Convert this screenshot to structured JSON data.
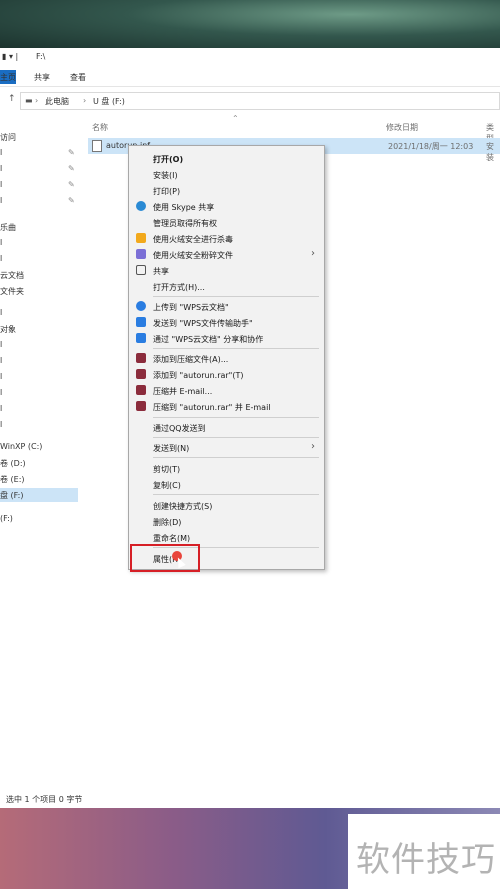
{
  "explorer": {
    "title_path": "F:\\",
    "ribbon_tabs": [
      "主页",
      "共享",
      "查看"
    ],
    "breadcrumb": [
      "此电脑",
      "U 盘 (F:)"
    ],
    "nav_items": [
      "访问",
      "",
      "",
      "",
      "",
      "乐曲",
      "",
      "云文档",
      "文件夹",
      "",
      "对象",
      "",
      "",
      "",
      "",
      "",
      "WinXP (C:)",
      "卷 (D:)",
      "卷 (E:)",
      "盘 (F:)",
      "",
      "(F:)"
    ],
    "columns": {
      "name": "名称",
      "date": "修改日期",
      "type": "类型"
    },
    "file": {
      "name": "autorun.inf",
      "date": "2021/1/18/周一 12:03",
      "type": "安装"
    },
    "status": "选中 1 个项目  0 字节"
  },
  "menu": {
    "items": [
      {
        "label": "打开(O)",
        "icon": "",
        "bold": true
      },
      {
        "label": "安装(I)",
        "icon": ""
      },
      {
        "label": "打印(P)",
        "icon": ""
      },
      {
        "label": "使用 Skype 共享",
        "icon": "skype-icon",
        "color": "#2a8ad4"
      },
      {
        "label": "管理员取得所有权",
        "icon": ""
      },
      {
        "label": "使用火绒安全进行杀毒",
        "icon": "huorong-icon",
        "color": "#f2a91c"
      },
      {
        "label": "使用火绒安全粉碎文件",
        "icon": "shred-icon",
        "color": "#7b6fd6"
      },
      {
        "label": "共享",
        "icon": "share-icon",
        "color": "#555555"
      },
      {
        "label": "打开方式(H)...",
        "icon": ""
      },
      {
        "label": "上传到 \"WPS云文档\"",
        "icon": "wps-cloud-icon",
        "color": "#2a7de1"
      },
      {
        "label": "发送到 \"WPS文件传输助手\"",
        "icon": "wps-send-icon",
        "color": "#2a7de1"
      },
      {
        "label": "通过 \"WPS云文档\" 分享和协作",
        "icon": "wps-share-icon",
        "color": "#2a7de1"
      },
      {
        "label": "添加到压缩文件(A)...",
        "icon": "winrar-icon",
        "color": "#8b2c3c"
      },
      {
        "label": "添加到 \"autorun.rar\"(T)",
        "icon": "winrar-icon",
        "color": "#8b2c3c"
      },
      {
        "label": "压缩并 E-mail...",
        "icon": "winrar-icon",
        "color": "#8b2c3c"
      },
      {
        "label": "压缩到 \"autorun.rar\" 并 E-mail",
        "icon": "winrar-icon",
        "color": "#8b2c3c"
      },
      {
        "label": "通过QQ发送到",
        "icon": ""
      },
      {
        "label": "发送到(N)",
        "icon": ""
      },
      {
        "label": "剪切(T)",
        "icon": ""
      },
      {
        "label": "复制(C)",
        "icon": ""
      },
      {
        "label": "创建快捷方式(S)",
        "icon": ""
      },
      {
        "label": "删除(D)",
        "icon": ""
      },
      {
        "label": "重命名(M)",
        "icon": ""
      },
      {
        "label": "属性(R)",
        "icon": ""
      }
    ]
  },
  "watermark": "软件技巧"
}
